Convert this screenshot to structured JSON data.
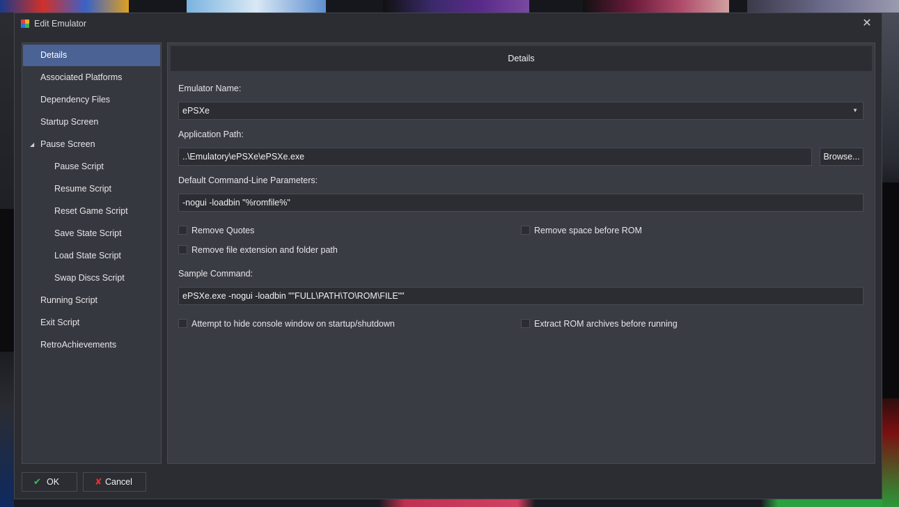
{
  "window": {
    "title": "Edit Emulator",
    "close_glyph": "✕"
  },
  "colors": {
    "selected": "#4a6294",
    "dialog_bg": "#2b2d33",
    "panel_bg": "#3a3c44",
    "ok_icon": "#3cc05a",
    "cancel_icon": "#e03030"
  },
  "nav": {
    "items": [
      {
        "label": "Details",
        "selected": true
      },
      {
        "label": "Associated Platforms"
      },
      {
        "label": "Dependency Files"
      },
      {
        "label": "Startup Screen"
      },
      {
        "label": "Pause Screen",
        "expanded": true
      },
      {
        "label": "Pause Script"
      },
      {
        "label": "Resume Script"
      },
      {
        "label": "Reset Game Script"
      },
      {
        "label": "Save State Script"
      },
      {
        "label": "Load State Script"
      },
      {
        "label": "Swap Discs Script"
      },
      {
        "label": "Running Script"
      },
      {
        "label": "Exit Script"
      },
      {
        "label": "RetroAchievements"
      }
    ]
  },
  "details": {
    "header": "Details",
    "emulator_name_label": "Emulator Name:",
    "emulator_name_value": "ePSXe",
    "app_path_label": "Application Path:",
    "app_path_value": "..\\Emulatory\\ePSXe\\ePSXe.exe",
    "browse_label": "Browse...",
    "cmd_params_label": "Default Command-Line Parameters:",
    "cmd_params_value": "-nogui -loadbin \"%romfile%\"",
    "remove_quotes": {
      "label": "Remove Quotes",
      "checked": false
    },
    "remove_space": {
      "label": "Remove space before ROM",
      "checked": false
    },
    "remove_ext": {
      "label": "Remove file extension and folder path",
      "checked": false
    },
    "sample_label": "Sample Command:",
    "sample_value": "ePSXe.exe -nogui -loadbin \"\"FULL\\PATH\\TO\\ROM\\FILE\"\"",
    "hide_console": {
      "label": "Attempt to hide console window on startup/shutdown",
      "checked": false
    },
    "extract_rom": {
      "label": "Extract ROM archives before running",
      "checked": false
    }
  },
  "footer": {
    "ok_label": "OK",
    "cancel_label": "Cancel",
    "ok_icon": "checkmark-icon",
    "cancel_icon": "x-icon"
  }
}
